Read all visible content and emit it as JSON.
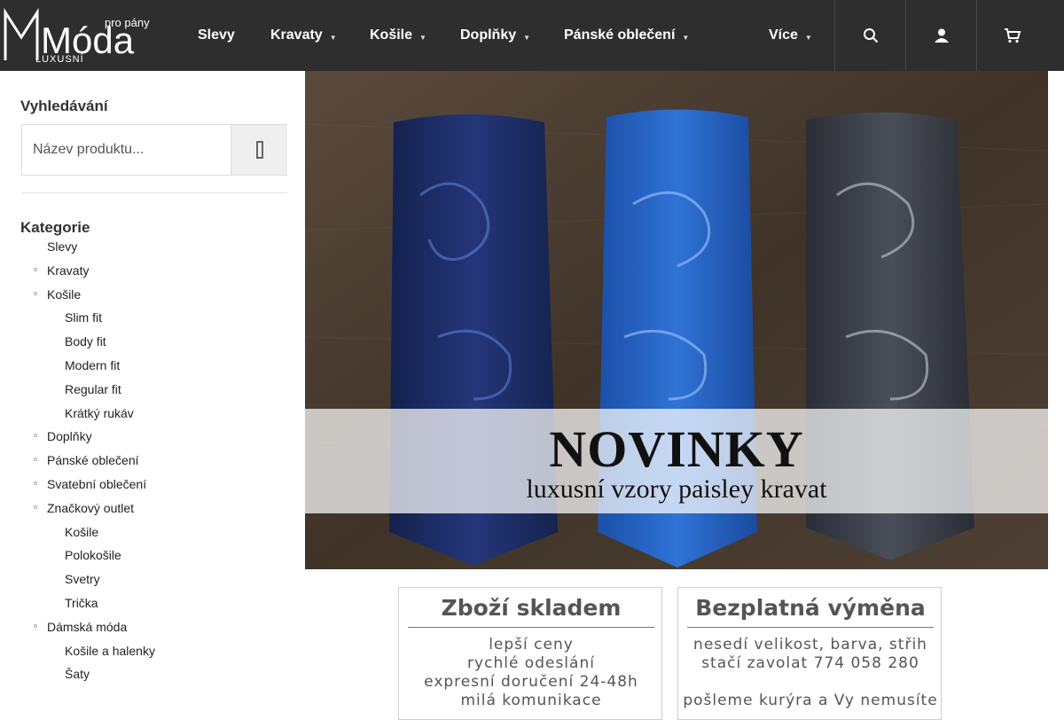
{
  "brand": {
    "logo_main": "Móda",
    "logo_top": "pro pány",
    "logo_sub": "LUXUSNÍ"
  },
  "nav": {
    "items": [
      {
        "label": "Slevy",
        "has_dropdown": false
      },
      {
        "label": "Kravaty",
        "has_dropdown": true
      },
      {
        "label": "Košile",
        "has_dropdown": true
      },
      {
        "label": "Doplňky",
        "has_dropdown": true
      },
      {
        "label": "Pánské oblečení",
        "has_dropdown": true
      },
      {
        "label": "Více",
        "has_dropdown": true
      }
    ],
    "icons": [
      "search-icon",
      "user-icon",
      "cart-icon"
    ]
  },
  "search": {
    "title": "Vyhledávání",
    "placeholder": "Název produktu..."
  },
  "categories": {
    "title": "Kategorie",
    "items": [
      {
        "label": "Slevy",
        "level": 0,
        "bullet": false
      },
      {
        "label": "Kravaty",
        "level": 0,
        "bullet": true
      },
      {
        "label": "Košile",
        "level": 0,
        "bullet": true
      },
      {
        "label": "Slim fit",
        "level": 1,
        "bullet": false
      },
      {
        "label": "Body fit",
        "level": 1,
        "bullet": false
      },
      {
        "label": "Modern fit",
        "level": 1,
        "bullet": false
      },
      {
        "label": "Regular fit",
        "level": 1,
        "bullet": false
      },
      {
        "label": "Krátký rukáv",
        "level": 1,
        "bullet": false
      },
      {
        "label": "Doplňky",
        "level": 0,
        "bullet": true
      },
      {
        "label": "Pánské oblečení",
        "level": 0,
        "bullet": true
      },
      {
        "label": "Svatební oblečení",
        "level": 0,
        "bullet": true
      },
      {
        "label": "Značkový outlet",
        "level": 0,
        "bullet": true
      },
      {
        "label": "Košile",
        "level": 1,
        "bullet": false
      },
      {
        "label": "Polokošile",
        "level": 1,
        "bullet": false
      },
      {
        "label": "Svetry",
        "level": 1,
        "bullet": false
      },
      {
        "label": "Trička",
        "level": 1,
        "bullet": false
      },
      {
        "label": "Dámská móda",
        "level": 0,
        "bullet": true
      },
      {
        "label": "Košile a halenky",
        "level": 1,
        "bullet": false
      },
      {
        "label": "Šaty",
        "level": 1,
        "bullet": false
      }
    ]
  },
  "banner": {
    "title": "NOVINKY",
    "subtitle": "luxusní vzory paisley kravat"
  },
  "cards": [
    {
      "title": "Zboží skladem",
      "lines": [
        "lepší ceny",
        "rychlé odeslání",
        "expresní doručení 24-48h",
        "milá komunikace"
      ]
    },
    {
      "title": "Bezplatná výměna",
      "lines": [
        "nesedí velikost, barva, střih",
        "stačí zavolat 774 058 280",
        "",
        "pošleme kurýra a Vy nemusíte"
      ]
    }
  ],
  "colors": {
    "header_bg": "#2e2e2e",
    "text": "#222222",
    "tie_navy": "#1b2a5c",
    "tie_blue": "#1f5fc0",
    "tie_grey": "#3a3d45"
  }
}
